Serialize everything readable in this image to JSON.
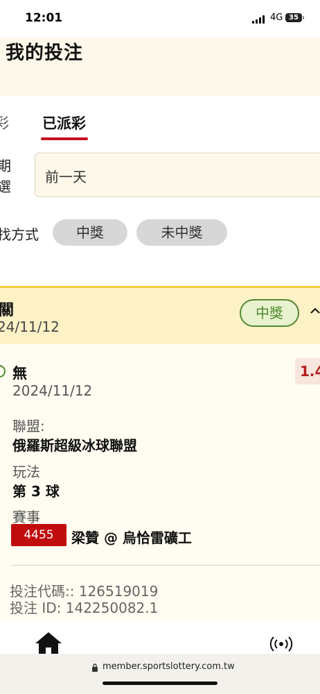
{
  "status_bar": {
    "time": "12:01",
    "network": "4G",
    "battery": "35"
  },
  "header": {
    "title": "我的投注"
  },
  "tabs": {
    "prev_partial": "彩",
    "active": "已派彩"
  },
  "date_filter": {
    "label_line1": "期",
    "label_line2": "選",
    "value": "前一天"
  },
  "result_filter": {
    "label": "找方式",
    "options": [
      "中獎",
      "未中獎"
    ]
  },
  "bet_card": {
    "title": "關",
    "date": "24/11/12",
    "status_badge": "中獎",
    "selection": "無",
    "selection_date": "2024/11/12",
    "odds": "1.4",
    "league_label": "聯盟:",
    "league_value": "俄羅斯超級冰球聯盟",
    "play_label": "玩法",
    "play_value": "第 3 球",
    "event_label": "賽事",
    "match_number": "4455",
    "match_name": "梁贊 @ 烏恰雷礦工",
    "bet_code": "投注代碼:: 126519019",
    "bet_id": "投注 ID: 142250082.1"
  },
  "browser": {
    "url": "member.sportslottery.com.tw"
  },
  "icons": {
    "home": "home-icon",
    "live": "live-broadcast-icon",
    "lock": "lock-icon",
    "chevron": "chevron-up-icon"
  },
  "colors": {
    "accent_red": "#c8101e",
    "win_green": "#4f8a2f",
    "card_header_bg": "#fdf1c6",
    "match_no_bg": "#c00d0d"
  }
}
